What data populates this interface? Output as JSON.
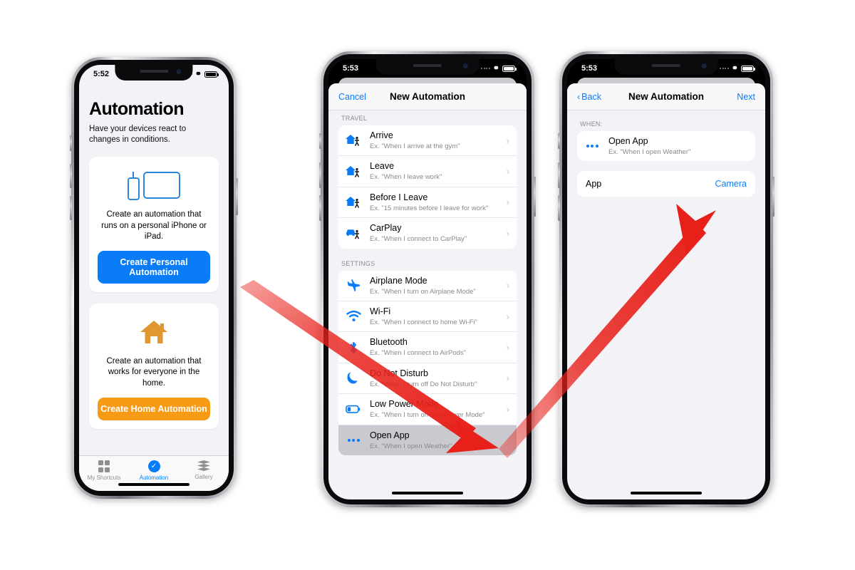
{
  "phone1": {
    "status": {
      "time": "5:52",
      "chain_icon": "link-icon",
      "battery_icon": "battery-icon"
    },
    "title": "Automation",
    "subtitle": "Have your devices react to changes in conditions.",
    "cards": [
      {
        "illustration": "devices-iphone-ipad-icon",
        "text": "Create an automation that runs on a personal iPhone or iPad.",
        "button": "Create Personal Automation",
        "button_color": "#0a7cf7"
      },
      {
        "illustration": "house-icon",
        "text": "Create an automation that works for everyone in the home.",
        "button": "Create Home Automation",
        "button_color": "#f79a16"
      }
    ],
    "tabs": [
      {
        "label": "My Shortcuts",
        "icon": "grid-icon",
        "active": false
      },
      {
        "label": "Automation",
        "icon": "check-circle-icon",
        "active": true
      },
      {
        "label": "Gallery",
        "icon": "layers-icon",
        "active": false
      }
    ]
  },
  "phone2": {
    "status": {
      "time": "5:53",
      "chain_icon": "link-icon",
      "battery_icon": "battery-icon"
    },
    "navbar": {
      "left": "Cancel",
      "title": "New Automation"
    },
    "sections": [
      {
        "header": "TRAVEL",
        "rows": [
          {
            "icon": "house-walk-icon",
            "title": "Arrive",
            "subtitle": "Ex. \"When I arrive at the gym\"",
            "selected": false
          },
          {
            "icon": "house-walk-icon",
            "title": "Leave",
            "subtitle": "Ex. \"When I leave work\"",
            "selected": false
          },
          {
            "icon": "house-walk-icon",
            "title": "Before I Leave",
            "subtitle": "Ex. \"15 minutes before I leave for work\"",
            "selected": false
          },
          {
            "icon": "car-walk-icon",
            "title": "CarPlay",
            "subtitle": "Ex. \"When I connect to CarPlay\"",
            "selected": false
          }
        ]
      },
      {
        "header": "SETTINGS",
        "rows": [
          {
            "icon": "airplane-icon",
            "title": "Airplane Mode",
            "subtitle": "Ex. \"When I turn on Airplane Mode\"",
            "selected": false
          },
          {
            "icon": "wifi-icon",
            "title": "Wi-Fi",
            "subtitle": "Ex. \"When I connect to home Wi-Fi\"",
            "selected": false
          },
          {
            "icon": "bluetooth-icon",
            "title": "Bluetooth",
            "subtitle": "Ex. \"When I connect to AirPods\"",
            "selected": false
          },
          {
            "icon": "moon-icon",
            "title": "Do Not Disturb",
            "subtitle": "Ex. \"When I turn off Do Not Disturb\"",
            "selected": false
          },
          {
            "icon": "battery-low-icon",
            "title": "Low Power Mode",
            "subtitle": "Ex. \"When I turn on Low Power Mode\"",
            "selected": false
          },
          {
            "icon": "dots-icon",
            "title": "Open App",
            "subtitle": "Ex. \"When I open Weather\"",
            "selected": true
          }
        ]
      }
    ]
  },
  "phone3": {
    "status": {
      "time": "5:53",
      "chain_icon": "link-icon",
      "battery_icon": "battery-icon"
    },
    "navbar": {
      "left": "Back",
      "title": "New Automation",
      "right": "Next"
    },
    "when_header": "WHEN:",
    "trigger": {
      "icon": "dots-icon",
      "title": "Open App",
      "subtitle": "Ex. \"When I open Weather\""
    },
    "app_row": {
      "label": "App",
      "value": "Camera"
    }
  },
  "annotations": {
    "arrow_color": "#e8201a",
    "arrows": [
      {
        "name": "arrow-create-personal-to-open-app",
        "from": "Create Personal Automation",
        "to": "Open App"
      },
      {
        "name": "arrow-open-app-to-camera",
        "from": "Open App",
        "to": "Camera"
      }
    ]
  }
}
